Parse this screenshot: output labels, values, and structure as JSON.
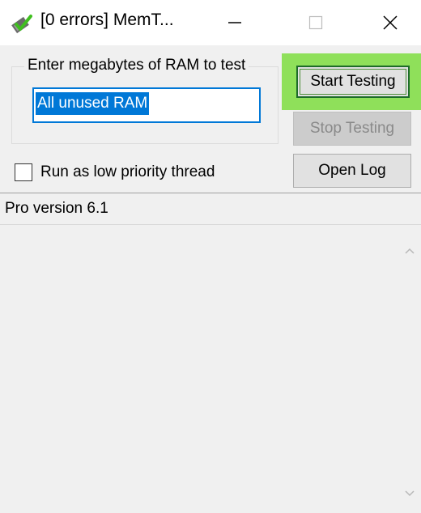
{
  "window": {
    "title": "[0 errors] MemT...",
    "app_icon": "memtest-icon",
    "controls": [
      "minimize-icon",
      "maximize-icon",
      "close-icon"
    ]
  },
  "ram_group": {
    "legend": "Enter megabytes of RAM to test",
    "input_value": "All unused RAM"
  },
  "buttons": {
    "start": "Start Testing",
    "stop": "Stop Testing",
    "open_log": "Open Log"
  },
  "options": {
    "low_priority_label": "Run as low priority thread",
    "low_priority_checked": false
  },
  "status": {
    "text": "Pro version 6.1"
  },
  "colors": {
    "highlight": "#8fe05a",
    "selection": "#0078d7"
  }
}
